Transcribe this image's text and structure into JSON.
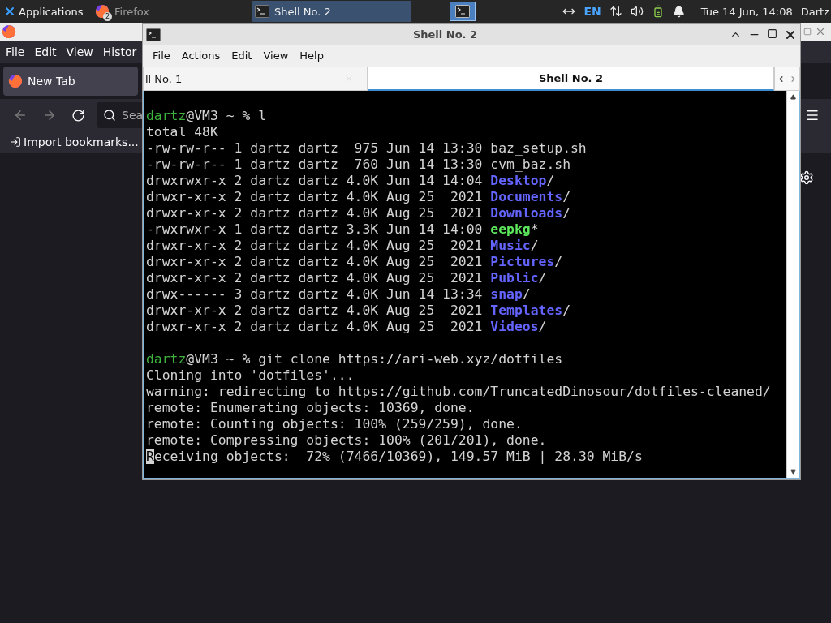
{
  "top_panel": {
    "menu_label": "Applications",
    "tasks": [
      {
        "label": "Firefox",
        "badge": "2",
        "selected": false
      },
      {
        "label": "Shell No. 2",
        "selected": true
      }
    ],
    "keyboard_layout": "EN",
    "clock": "Tue 14 Jun, 14:08",
    "user": "Dartz"
  },
  "firefox": {
    "menu": [
      "File",
      "Edit",
      "View",
      "Histor"
    ],
    "tab": "New Tab",
    "search_placeholder": "Sea",
    "bookmark": "Import bookmarks..."
  },
  "terminal": {
    "title": "Shell No. 2",
    "menu": [
      "File",
      "Actions",
      "Edit",
      "View",
      "Help"
    ],
    "tabs": [
      {
        "label": "ll No. 1",
        "selected": false
      },
      {
        "label": "Shell No. 2",
        "selected": true
      }
    ],
    "lines": [
      {
        "kind": "blank"
      },
      {
        "kind": "text",
        "segments": [
          {
            "text": "dartz",
            "kind": "user"
          },
          {
            "text": "@VM3 ~ % l",
            "kind": "plain"
          }
        ]
      },
      {
        "kind": "text",
        "segments": [
          {
            "text": "total 48K",
            "kind": "plain"
          }
        ]
      },
      {
        "kind": "text",
        "segments": [
          {
            "text": "-rw-rw-r-- 1 dartz dartz  975 Jun 14 13:30 baz_setup.sh",
            "kind": "plain"
          }
        ]
      },
      {
        "kind": "text",
        "segments": [
          {
            "text": "-rw-rw-r-- 1 dartz dartz  760 Jun 14 13:30 cvm_baz.sh",
            "kind": "plain"
          }
        ]
      },
      {
        "kind": "text",
        "segments": [
          {
            "text": "drwxrwxr-x 2 dartz dartz 4.0K Jun 14 14:04 ",
            "kind": "plain"
          },
          {
            "text": "Desktop",
            "kind": "dir"
          },
          {
            "text": "/",
            "kind": "plain"
          }
        ]
      },
      {
        "kind": "text",
        "segments": [
          {
            "text": "drwxr-xr-x 2 dartz dartz 4.0K Aug 25  2021 ",
            "kind": "plain"
          },
          {
            "text": "Documents",
            "kind": "dir"
          },
          {
            "text": "/",
            "kind": "plain"
          }
        ]
      },
      {
        "kind": "text",
        "segments": [
          {
            "text": "drwxr-xr-x 2 dartz dartz 4.0K Aug 25  2021 ",
            "kind": "plain"
          },
          {
            "text": "Downloads",
            "kind": "dir"
          },
          {
            "text": "/",
            "kind": "plain"
          }
        ]
      },
      {
        "kind": "text",
        "segments": [
          {
            "text": "-rwxrwxr-x 1 dartz dartz 3.3K Jun 14 14:00 ",
            "kind": "plain"
          },
          {
            "text": "eepkg",
            "kind": "exec"
          },
          {
            "text": "*",
            "kind": "plain"
          }
        ]
      },
      {
        "kind": "text",
        "segments": [
          {
            "text": "drwxr-xr-x 2 dartz dartz 4.0K Aug 25  2021 ",
            "kind": "plain"
          },
          {
            "text": "Music",
            "kind": "dir"
          },
          {
            "text": "/",
            "kind": "plain"
          }
        ]
      },
      {
        "kind": "text",
        "segments": [
          {
            "text": "drwxr-xr-x 2 dartz dartz 4.0K Aug 25  2021 ",
            "kind": "plain"
          },
          {
            "text": "Pictures",
            "kind": "dir"
          },
          {
            "text": "/",
            "kind": "plain"
          }
        ]
      },
      {
        "kind": "text",
        "segments": [
          {
            "text": "drwxr-xr-x 2 dartz dartz 4.0K Aug 25  2021 ",
            "kind": "plain"
          },
          {
            "text": "Public",
            "kind": "dir"
          },
          {
            "text": "/",
            "kind": "plain"
          }
        ]
      },
      {
        "kind": "text",
        "segments": [
          {
            "text": "drwx------ 3 dartz dartz 4.0K Jun 14 13:34 ",
            "kind": "plain"
          },
          {
            "text": "snap",
            "kind": "dir"
          },
          {
            "text": "/",
            "kind": "plain"
          }
        ]
      },
      {
        "kind": "text",
        "segments": [
          {
            "text": "drwxr-xr-x 2 dartz dartz 4.0K Aug 25  2021 ",
            "kind": "plain"
          },
          {
            "text": "Templates",
            "kind": "dir"
          },
          {
            "text": "/",
            "kind": "plain"
          }
        ]
      },
      {
        "kind": "text",
        "segments": [
          {
            "text": "drwxr-xr-x 2 dartz dartz 4.0K Aug 25  2021 ",
            "kind": "plain"
          },
          {
            "text": "Videos",
            "kind": "dir"
          },
          {
            "text": "/",
            "kind": "plain"
          }
        ]
      },
      {
        "kind": "blank"
      },
      {
        "kind": "text",
        "segments": [
          {
            "text": "dartz",
            "kind": "user"
          },
          {
            "text": "@VM3 ~ % git clone https://ari-web.xyz/dotfiles",
            "kind": "plain"
          }
        ]
      },
      {
        "kind": "text",
        "segments": [
          {
            "text": "Cloning into 'dotfiles'...",
            "kind": "plain"
          }
        ]
      },
      {
        "kind": "text",
        "segments": [
          {
            "text": "warning: redirecting to ",
            "kind": "plain"
          },
          {
            "text": "https://github.com/TruncatedDinosour/dotfiles-cleaned/",
            "kind": "link"
          }
        ]
      },
      {
        "kind": "text",
        "segments": [
          {
            "text": "remote: Enumerating objects: 10369, done.",
            "kind": "plain"
          }
        ]
      },
      {
        "kind": "text",
        "segments": [
          {
            "text": "remote: Counting objects: 100% (259/259), done.",
            "kind": "plain"
          }
        ]
      },
      {
        "kind": "text",
        "segments": [
          {
            "text": "remote: Compressing objects: 100% (201/201), done.",
            "kind": "plain"
          }
        ]
      },
      {
        "kind": "text",
        "segments": [
          {
            "text": "R",
            "kind": "cursor"
          },
          {
            "text": "eceiving objects:  72% (7466/10369), 149.57 MiB | 28.30 MiB/s",
            "kind": "plain"
          }
        ]
      }
    ]
  }
}
